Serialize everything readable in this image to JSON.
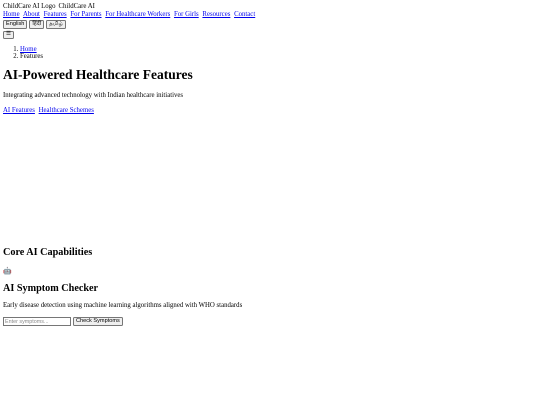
{
  "header": {
    "logo_alt": "ChildCare AI Logo",
    "brand": "ChildCare AI",
    "nav": [
      "Home",
      "About",
      "Features",
      "For Parents",
      "For Healthcare Workers",
      "For Girls",
      "Resources",
      "Contact"
    ],
    "languages": [
      "English",
      "हिंदी",
      "தமிழ்"
    ],
    "menu_icon": "☰"
  },
  "breadcrumb": [
    "Home",
    "Features"
  ],
  "hero": {
    "title": "AI-Powered Healthcare Features",
    "subtitle": "Integrating advanced technology with Indian healthcare initiatives",
    "tabs": [
      "AI Features",
      "Healthcare Schemes"
    ]
  },
  "capabilities": {
    "heading": "Core AI Capabilities",
    "card": {
      "icon": "🤖",
      "icon_name": "robot-icon",
      "title": "AI Symptom Checker",
      "description": "Early disease detection using machine learning algorithms aligned with WHO standards",
      "input_placeholder": "Enter symptoms...",
      "button_label": "Check Symptoms"
    }
  }
}
